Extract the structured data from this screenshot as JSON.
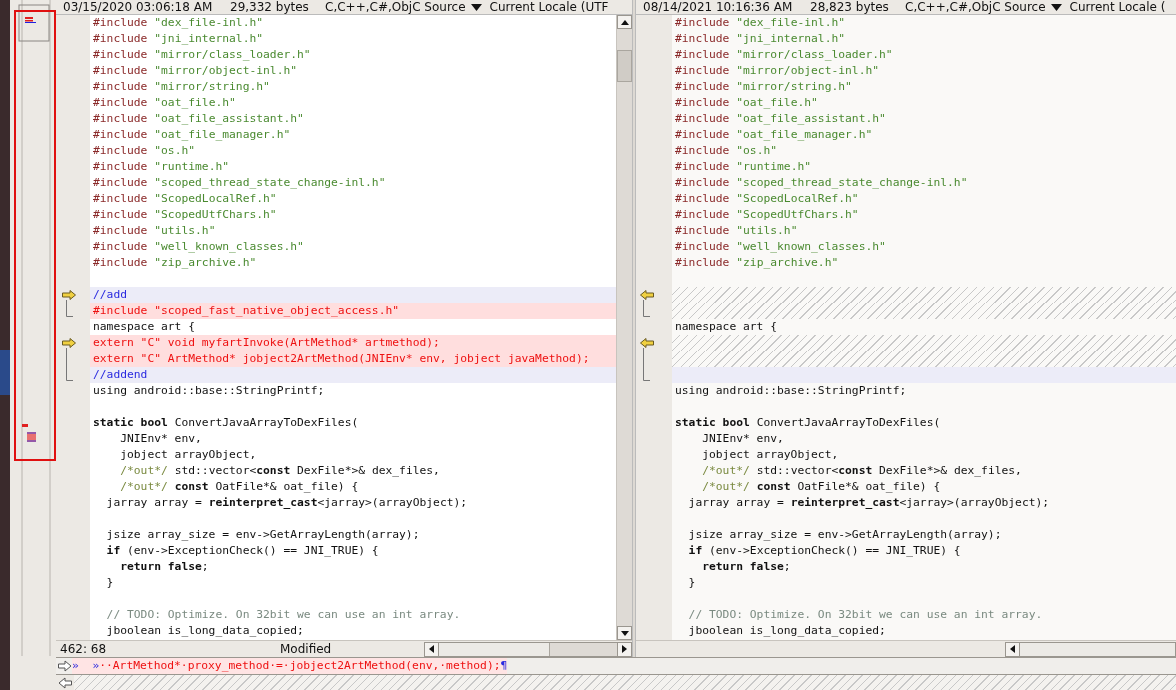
{
  "left_pane": {
    "header": {
      "date": "03/15/2020 03:06:18 AM",
      "size": "29,332 bytes",
      "format": "C,C++,C#,ObjC Source",
      "encoding": "Current Locale (UTF"
    },
    "lines": [
      {
        "kind": "same",
        "segments": [
          {
            "text": "#include",
            "kind": "directive"
          },
          {
            "text": " \"dex_file-inl.h\"",
            "kind": "string"
          }
        ]
      },
      {
        "kind": "same",
        "segments": [
          {
            "text": "#include",
            "kind": "directive"
          },
          {
            "text": " \"jni_internal.h\"",
            "kind": "string"
          }
        ]
      },
      {
        "kind": "same",
        "segments": [
          {
            "text": "#include",
            "kind": "directive"
          },
          {
            "text": " \"mirror/class_loader.h\"",
            "kind": "string"
          }
        ]
      },
      {
        "kind": "same",
        "segments": [
          {
            "text": "#include",
            "kind": "directive"
          },
          {
            "text": " \"mirror/object-inl.h\"",
            "kind": "string"
          }
        ]
      },
      {
        "kind": "same",
        "segments": [
          {
            "text": "#include",
            "kind": "directive"
          },
          {
            "text": " \"mirror/string.h\"",
            "kind": "string"
          }
        ]
      },
      {
        "kind": "same",
        "segments": [
          {
            "text": "#include",
            "kind": "directive"
          },
          {
            "text": " \"oat_file.h\"",
            "kind": "string"
          }
        ]
      },
      {
        "kind": "same",
        "segments": [
          {
            "text": "#include",
            "kind": "directive"
          },
          {
            "text": " \"oat_file_assistant.h\"",
            "kind": "string"
          }
        ]
      },
      {
        "kind": "same",
        "segments": [
          {
            "text": "#include",
            "kind": "directive"
          },
          {
            "text": " \"oat_file_manager.h\"",
            "kind": "string"
          }
        ]
      },
      {
        "kind": "same",
        "segments": [
          {
            "text": "#include",
            "kind": "directive"
          },
          {
            "text": " \"os.h\"",
            "kind": "string"
          }
        ]
      },
      {
        "kind": "same",
        "segments": [
          {
            "text": "#include",
            "kind": "directive"
          },
          {
            "text": " \"runtime.h\"",
            "kind": "string"
          }
        ]
      },
      {
        "kind": "same",
        "segments": [
          {
            "text": "#include",
            "kind": "directive"
          },
          {
            "text": " \"scoped_thread_state_change-inl.h\"",
            "kind": "string"
          }
        ]
      },
      {
        "kind": "same",
        "segments": [
          {
            "text": "#include",
            "kind": "directive"
          },
          {
            "text": " \"ScopedLocalRef.h\"",
            "kind": "string"
          }
        ]
      },
      {
        "kind": "same",
        "segments": [
          {
            "text": "#include",
            "kind": "directive"
          },
          {
            "text": " \"ScopedUtfChars.h\"",
            "kind": "string"
          }
        ]
      },
      {
        "kind": "same",
        "segments": [
          {
            "text": "#include",
            "kind": "directive"
          },
          {
            "text": " \"utils.h\"",
            "kind": "string"
          }
        ]
      },
      {
        "kind": "same",
        "segments": [
          {
            "text": "#include",
            "kind": "directive"
          },
          {
            "text": " \"well_known_classes.h\"",
            "kind": "string"
          }
        ]
      },
      {
        "kind": "same",
        "segments": [
          {
            "text": "#include",
            "kind": "directive"
          },
          {
            "text": " \"zip_archive.h\"",
            "kind": "string"
          }
        ]
      },
      {
        "kind": "blank"
      },
      {
        "kind": "minor",
        "block_start": true,
        "segments": [
          {
            "text": "//add",
            "kind": "comment"
          }
        ]
      },
      {
        "kind": "changed",
        "in_block": true,
        "segments": [
          {
            "text": "#include \"scoped_fast_native_object_access.h\"",
            "kind": "code"
          }
        ]
      },
      {
        "kind": "same",
        "segments": [
          {
            "text": "namespace art {",
            "kind": "code"
          }
        ]
      },
      {
        "kind": "changed",
        "block_start": true,
        "segments": [
          {
            "text": "extern \"C\" void myfartInvoke(ArtMethod* artmethod);",
            "kind": "code"
          }
        ]
      },
      {
        "kind": "changed",
        "in_block": true,
        "segments": [
          {
            "text": "extern \"C\" ArtMethod* jobject2ArtMethod(JNIEnv* env, jobject javaMethod);",
            "kind": "code"
          }
        ]
      },
      {
        "kind": "minor",
        "in_block": true,
        "segments": [
          {
            "text": "//addend",
            "kind": "comment"
          }
        ]
      },
      {
        "kind": "same",
        "segments": [
          {
            "text": "using android::base::StringPrintf;",
            "kind": "code"
          }
        ]
      },
      {
        "kind": "blank"
      },
      {
        "kind": "same",
        "segments": [
          {
            "text": "static bool",
            "kind": "keyword"
          },
          {
            "text": " ConvertJavaArrayToDexFiles(",
            "kind": "code"
          }
        ]
      },
      {
        "kind": "same",
        "segments": [
          {
            "text": "    JNIEnv* env,",
            "kind": "code"
          }
        ]
      },
      {
        "kind": "same",
        "segments": [
          {
            "text": "    jobject arrayObject,",
            "kind": "code"
          }
        ]
      },
      {
        "kind": "same",
        "segments": [
          {
            "text": "    /*out*/",
            "kind": "comment"
          },
          {
            "text": " std::vector<",
            "kind": "code"
          },
          {
            "text": "const",
            "kind": "keyword"
          },
          {
            "text": " DexFile*>& dex_files,",
            "kind": "code"
          }
        ]
      },
      {
        "kind": "same",
        "segments": [
          {
            "text": "    /*out*/",
            "kind": "comment"
          },
          {
            "text": " const",
            "kind": "keyword"
          },
          {
            "text": " OatFile*& oat_file) {",
            "kind": "code"
          }
        ]
      },
      {
        "kind": "same",
        "segments": [
          {
            "text": "  jarray array = ",
            "kind": "code"
          },
          {
            "text": "reinterpret_cast",
            "kind": "keyword"
          },
          {
            "text": "<jarray>(arrayObject);",
            "kind": "code"
          }
        ]
      },
      {
        "kind": "blank"
      },
      {
        "kind": "same",
        "segments": [
          {
            "text": "  jsize array_size = env->GetArrayLength(array);",
            "kind": "code"
          }
        ]
      },
      {
        "kind": "same",
        "segments": [
          {
            "text": "  if",
            "kind": "keyword"
          },
          {
            "text": " (env->ExceptionCheck() == JNI_TRUE) {",
            "kind": "code"
          }
        ]
      },
      {
        "kind": "same",
        "segments": [
          {
            "text": "    return false",
            "kind": "keyword"
          },
          {
            "text": ";",
            "kind": "code"
          }
        ]
      },
      {
        "kind": "same",
        "segments": [
          {
            "text": "  }",
            "kind": "code"
          }
        ]
      },
      {
        "kind": "blank"
      },
      {
        "kind": "same",
        "segments": [
          {
            "text": "  // TODO: Optimize. On 32bit we can use an int array.",
            "kind": "note"
          }
        ]
      },
      {
        "kind": "same",
        "segments": [
          {
            "text": "  jboolean is_long_data_copied;",
            "kind": "code"
          }
        ]
      }
    ],
    "status": {
      "position": "462: 68",
      "state": "Modified"
    }
  },
  "right_pane": {
    "header": {
      "date": "08/14/2021 10:16:36 AM",
      "size": "28,823 bytes",
      "format": "C,C++,C#,ObjC Source",
      "encoding": "Current Locale ("
    },
    "lines": [
      {
        "kind": "same",
        "segments": [
          {
            "text": "#include",
            "kind": "directive"
          },
          {
            "text": " \"dex_file-inl.h\"",
            "kind": "string"
          }
        ]
      },
      {
        "kind": "same",
        "segments": [
          {
            "text": "#include",
            "kind": "directive"
          },
          {
            "text": " \"jni_internal.h\"",
            "kind": "string"
          }
        ]
      },
      {
        "kind": "same",
        "segments": [
          {
            "text": "#include",
            "kind": "directive"
          },
          {
            "text": " \"mirror/class_loader.h\"",
            "kind": "string"
          }
        ]
      },
      {
        "kind": "same",
        "segments": [
          {
            "text": "#include",
            "kind": "directive"
          },
          {
            "text": " \"mirror/object-inl.h\"",
            "kind": "string"
          }
        ]
      },
      {
        "kind": "same",
        "segments": [
          {
            "text": "#include",
            "kind": "directive"
          },
          {
            "text": " \"mirror/string.h\"",
            "kind": "string"
          }
        ]
      },
      {
        "kind": "same",
        "segments": [
          {
            "text": "#include",
            "kind": "directive"
          },
          {
            "text": " \"oat_file.h\"",
            "kind": "string"
          }
        ]
      },
      {
        "kind": "same",
        "segments": [
          {
            "text": "#include",
            "kind": "directive"
          },
          {
            "text": " \"oat_file_assistant.h\"",
            "kind": "string"
          }
        ]
      },
      {
        "kind": "same",
        "segments": [
          {
            "text": "#include",
            "kind": "directive"
          },
          {
            "text": " \"oat_file_manager.h\"",
            "kind": "string"
          }
        ]
      },
      {
        "kind": "same",
        "segments": [
          {
            "text": "#include",
            "kind": "directive"
          },
          {
            "text": " \"os.h\"",
            "kind": "string"
          }
        ]
      },
      {
        "kind": "same",
        "segments": [
          {
            "text": "#include",
            "kind": "directive"
          },
          {
            "text": " \"runtime.h\"",
            "kind": "string"
          }
        ]
      },
      {
        "kind": "same",
        "segments": [
          {
            "text": "#include",
            "kind": "directive"
          },
          {
            "text": " \"scoped_thread_state_change-inl.h\"",
            "kind": "string"
          }
        ]
      },
      {
        "kind": "same",
        "segments": [
          {
            "text": "#include",
            "kind": "directive"
          },
          {
            "text": " \"ScopedLocalRef.h\"",
            "kind": "string"
          }
        ]
      },
      {
        "kind": "same",
        "segments": [
          {
            "text": "#include",
            "kind": "directive"
          },
          {
            "text": " \"ScopedUtfChars.h\"",
            "kind": "string"
          }
        ]
      },
      {
        "kind": "same",
        "segments": [
          {
            "text": "#include",
            "kind": "directive"
          },
          {
            "text": " \"utils.h\"",
            "kind": "string"
          }
        ]
      },
      {
        "kind": "same",
        "segments": [
          {
            "text": "#include",
            "kind": "directive"
          },
          {
            "text": " \"well_known_classes.h\"",
            "kind": "string"
          }
        ]
      },
      {
        "kind": "same",
        "segments": [
          {
            "text": "#include",
            "kind": "directive"
          },
          {
            "text": " \"zip_archive.h\"",
            "kind": "string"
          }
        ]
      },
      {
        "kind": "blank"
      },
      {
        "kind": "missing",
        "block_start": true
      },
      {
        "kind": "missing",
        "in_block": true
      },
      {
        "kind": "same",
        "segments": [
          {
            "text": "namespace art {",
            "kind": "code"
          }
        ]
      },
      {
        "kind": "missing",
        "block_start": true
      },
      {
        "kind": "missing",
        "in_block": true
      },
      {
        "kind": "minor",
        "in_block": true
      },
      {
        "kind": "same",
        "segments": [
          {
            "text": "using android::base::StringPrintf;",
            "kind": "code"
          }
        ]
      },
      {
        "kind": "blank"
      },
      {
        "kind": "same",
        "segments": [
          {
            "text": "static bool",
            "kind": "keyword"
          },
          {
            "text": " ConvertJavaArrayToDexFiles(",
            "kind": "code"
          }
        ]
      },
      {
        "kind": "same",
        "segments": [
          {
            "text": "    JNIEnv* env,",
            "kind": "code"
          }
        ]
      },
      {
        "kind": "same",
        "segments": [
          {
            "text": "    jobject arrayObject,",
            "kind": "code"
          }
        ]
      },
      {
        "kind": "same",
        "segments": [
          {
            "text": "    /*out*/",
            "kind": "comment"
          },
          {
            "text": " std::vector<",
            "kind": "code"
          },
          {
            "text": "const",
            "kind": "keyword"
          },
          {
            "text": " DexFile*>& dex_files,",
            "kind": "code"
          }
        ]
      },
      {
        "kind": "same",
        "segments": [
          {
            "text": "    /*out*/",
            "kind": "comment"
          },
          {
            "text": " const",
            "kind": "keyword"
          },
          {
            "text": " OatFile*& oat_file) {",
            "kind": "code"
          }
        ]
      },
      {
        "kind": "same",
        "segments": [
          {
            "text": "  jarray array = ",
            "kind": "code"
          },
          {
            "text": "reinterpret_cast",
            "kind": "keyword"
          },
          {
            "text": "<jarray>(arrayObject);",
            "kind": "code"
          }
        ]
      },
      {
        "kind": "blank"
      },
      {
        "kind": "same",
        "segments": [
          {
            "text": "  jsize array_size = env->GetArrayLength(array);",
            "kind": "code"
          }
        ]
      },
      {
        "kind": "same",
        "segments": [
          {
            "text": "  if",
            "kind": "keyword"
          },
          {
            "text": " (env->ExceptionCheck() == JNI_TRUE) {",
            "kind": "code"
          }
        ]
      },
      {
        "kind": "same",
        "segments": [
          {
            "text": "    return false",
            "kind": "keyword"
          },
          {
            "text": ";",
            "kind": "code"
          }
        ]
      },
      {
        "kind": "same",
        "segments": [
          {
            "text": "  }",
            "kind": "code"
          }
        ]
      },
      {
        "kind": "blank"
      },
      {
        "kind": "same",
        "segments": [
          {
            "text": "  // TODO: Optimize. On 32bit we can use an int array.",
            "kind": "note"
          }
        ]
      },
      {
        "kind": "same",
        "segments": [
          {
            "text": "  jboolean is_long_data_copied;",
            "kind": "code"
          }
        ]
      }
    ]
  },
  "line_detail": {
    "tab_marks": "»  »",
    "text": "··ArtMethod*·proxy_method·=·jobject2ArtMethod(env,·method);",
    "end_mark": "¶"
  }
}
